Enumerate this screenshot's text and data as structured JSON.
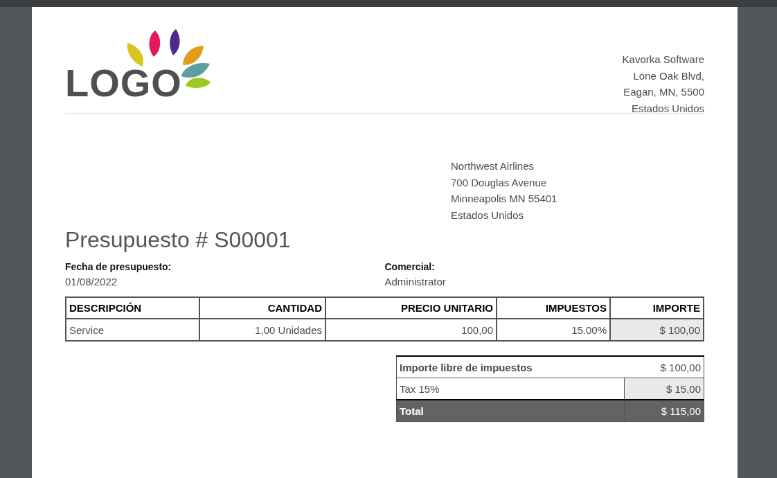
{
  "logo": {
    "text": "LOGO"
  },
  "company_address": [
    "Kavorka Software",
    "Lone Oak Blvd,",
    "Eagan, MN, 5500",
    "Estados Unidos"
  ],
  "customer_address": [
    "Northwest Airlines",
    "700 Douglas Avenue",
    "Minneapolis MN 55401",
    "Estados Unidos"
  ],
  "title": "Presupuesto # S00001",
  "info": [
    {
      "label": "Fecha de presupuesto:",
      "value": "01/08/2022"
    },
    {
      "label": "Comercial:",
      "value": "Administrator"
    }
  ],
  "table": {
    "columns": [
      "DESCRIPCIÓN",
      "CANTIDAD",
      "PRECIO UNITARIO",
      "IMPUESTOS",
      "IMPORTE"
    ],
    "rows": [
      [
        "Service",
        "1,00 Unidades",
        "100,00",
        "15.00%",
        "$ 100,00"
      ]
    ]
  },
  "totals": [
    {
      "kind": "subtotal",
      "label": "Importe libre de impuestos",
      "value": "$ 100,00"
    },
    {
      "kind": "tax",
      "label": "Tax 15%",
      "value": "$ 15,00"
    },
    {
      "kind": "total",
      "label": "Total",
      "value": "$ 115,00"
    }
  ]
}
